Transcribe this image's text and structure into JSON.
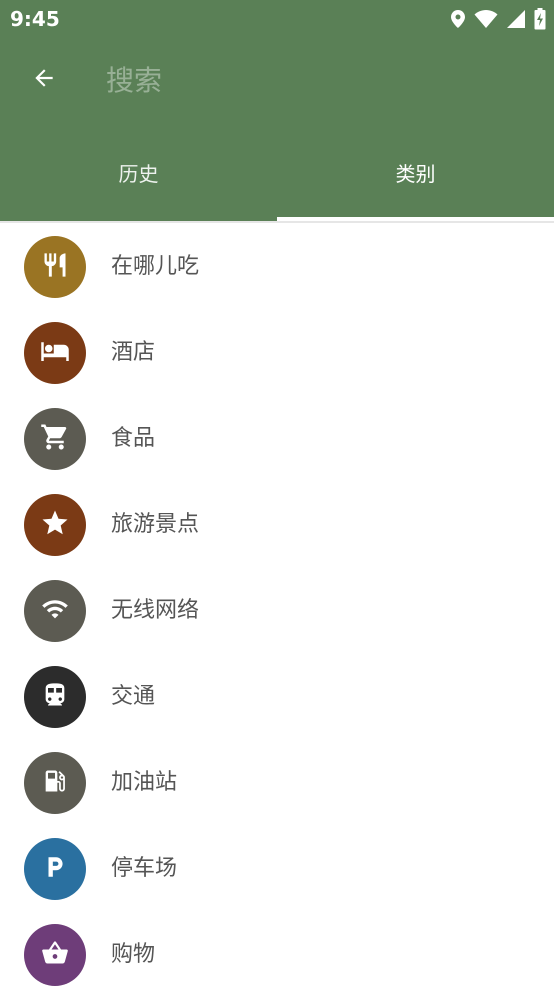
{
  "status_bar": {
    "time": "9:45",
    "icons": [
      "location-icon",
      "wifi-icon",
      "signal-icon",
      "battery-charging-icon"
    ]
  },
  "toolbar": {
    "back_icon": "arrow-back-icon",
    "search_placeholder": "搜索"
  },
  "tabs": [
    {
      "label": "历史",
      "selected": false
    },
    {
      "label": "类别",
      "selected": true
    }
  ],
  "colors": {
    "appbar": "#5a8056",
    "text_on_appbar": "#ffffff",
    "item_text": "#555555"
  },
  "categories": [
    {
      "label": "在哪儿吃",
      "icon": "fork-knife-icon",
      "color": "#9a7423"
    },
    {
      "label": "酒店",
      "icon": "bed-icon",
      "color": "#7b3a15"
    },
    {
      "label": "食品",
      "icon": "cart-icon",
      "color": "#5c5b52"
    },
    {
      "label": "旅游景点",
      "icon": "star-icon",
      "color": "#7b3a15"
    },
    {
      "label": "无线网络",
      "icon": "wifi-icon",
      "color": "#5c5b52"
    },
    {
      "label": "交通",
      "icon": "train-icon",
      "color": "#2c2c2c"
    },
    {
      "label": "加油站",
      "icon": "fuel-pump-icon",
      "color": "#5c5b52"
    },
    {
      "label": "停车场",
      "icon": "parking-icon",
      "color": "#2a70a0"
    },
    {
      "label": "购物",
      "icon": "shopping-basket-icon",
      "color": "#6e3d79"
    }
  ]
}
